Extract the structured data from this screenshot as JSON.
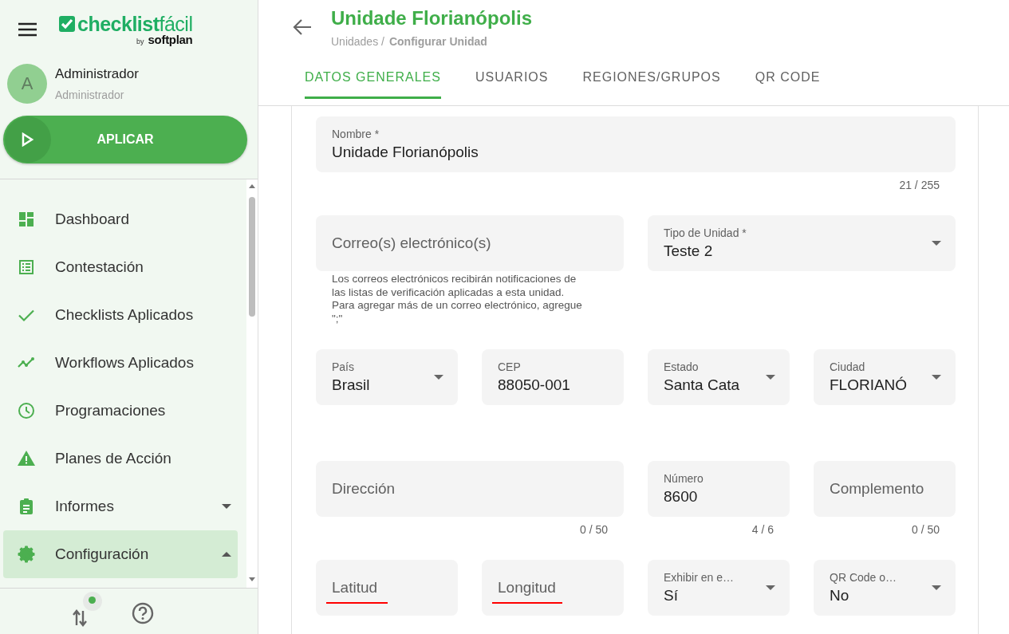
{
  "sidebar": {
    "logo": {
      "name": "**checklist**fácil",
      "by": "by",
      "maker": "softplan"
    },
    "user": {
      "initial": "A",
      "name": "Administrador",
      "role": "Administrador"
    },
    "apply_button": "APLICAR",
    "items": [
      {
        "label": "Dashboard",
        "kind": "dashboard",
        "selected": false
      },
      {
        "label": "Contestación",
        "kind": "list",
        "selected": false
      },
      {
        "label": "Checklists Aplicados",
        "kind": "check",
        "selected": false
      },
      {
        "label": "Workflows Aplicados",
        "kind": "trend",
        "selected": false
      },
      {
        "label": "Programaciones",
        "kind": "clock",
        "selected": false
      },
      {
        "label": "Planes de Acción",
        "kind": "warning",
        "selected": false
      },
      {
        "label": "Informes",
        "kind": "clipboard",
        "selected": false,
        "expanded": false
      },
      {
        "label": "Configuración",
        "kind": "gear",
        "selected": true,
        "expanded": true
      }
    ],
    "sync_online": true
  },
  "header": {
    "title": "Unidade Florianópolis",
    "breadcrumb": [
      "Unidades /",
      "Configurar Unidad"
    ]
  },
  "tabs": [
    {
      "label": "DATOS GENERALES",
      "selected": true
    },
    {
      "label": "USUARIOS",
      "selected": false
    },
    {
      "label": "REGIONES/GRUPOS",
      "selected": false
    },
    {
      "label": "QR CODE",
      "selected": false
    }
  ],
  "form": {
    "fields": [
      {
        "kind": "text",
        "label": "Nombre *",
        "value": "Unidade Florianópolis",
        "counter": "21 / 255"
      },
      {
        "kind": "text",
        "label": "Correo(s) electrónico(s)",
        "helper": "Los correos electrónicos recibirán notificaciones de las listas de verificación aplicadas a esta unidad. Para agregar más de un correo electrónico, agregue \";\""
      },
      {
        "kind": "select",
        "label": "Tipo de Unidad *",
        "value": "Teste 2"
      },
      {
        "kind": "select",
        "label": "País",
        "value": "Brasil"
      },
      {
        "kind": "text",
        "label": "CEP",
        "value": "88050-001"
      },
      {
        "kind": "select",
        "label": "Estado",
        "value": "Santa Cata"
      },
      {
        "kind": "select",
        "label": "Ciudad",
        "value": "FLORIANÓ"
      },
      {
        "kind": "text",
        "label": "Dirección",
        "counter": "0 / 50"
      },
      {
        "kind": "text",
        "label": "Número",
        "value": "8600",
        "counter": "4 / 6"
      },
      {
        "kind": "text",
        "label": "Complemento",
        "counter": "0 / 50"
      },
      {
        "kind": "text",
        "label": "Latitud",
        "underlined": true
      },
      {
        "kind": "text",
        "label": "Longitud",
        "underlined": true
      },
      {
        "kind": "select",
        "label": "Exhibir en e…",
        "value": "Sí"
      },
      {
        "kind": "select",
        "label": "QR Code o…",
        "value": "No"
      }
    ]
  }
}
